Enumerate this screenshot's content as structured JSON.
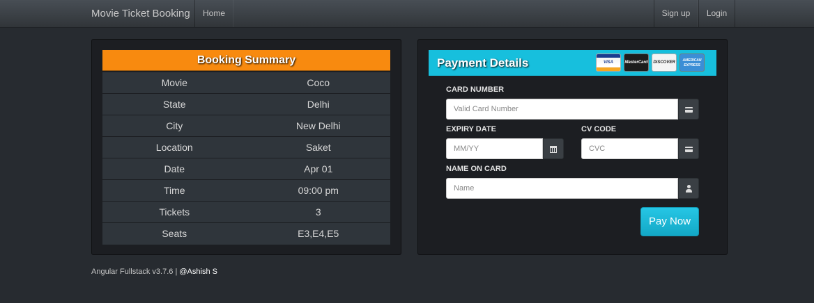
{
  "navbar": {
    "brand": "Movie Ticket Booking",
    "home": "Home",
    "signup": "Sign up",
    "login": "Login"
  },
  "summary": {
    "title": "Booking Summary",
    "rows": [
      {
        "label": "Movie",
        "value": "Coco"
      },
      {
        "label": "State",
        "value": "Delhi"
      },
      {
        "label": "City",
        "value": "New Delhi"
      },
      {
        "label": "Location",
        "value": "Saket"
      },
      {
        "label": "Date",
        "value": "Apr 01"
      },
      {
        "label": "Time",
        "value": "09:00 pm"
      },
      {
        "label": "Tickets",
        "value": "3"
      },
      {
        "label": "Seats",
        "value": "E3,E4,E5"
      }
    ]
  },
  "payment": {
    "title": "Payment Details",
    "cards": [
      "VISA",
      "MasterCard",
      "DISCOVER",
      "AMERICAN EXPRESS"
    ],
    "card_number_label": "CARD NUMBER",
    "card_number_placeholder": "Valid Card Number",
    "expiry_label": "EXPIRY DATE",
    "expiry_placeholder": "MM/YY",
    "cv_label": "CV CODE",
    "cv_placeholder": "CVC",
    "name_label": "NAME ON CARD",
    "name_placeholder": "Name",
    "pay_button": "Pay Now"
  },
  "footer": {
    "text": "Angular Fullstack v3.7.6 | ",
    "author": "@Ashish S"
  }
}
